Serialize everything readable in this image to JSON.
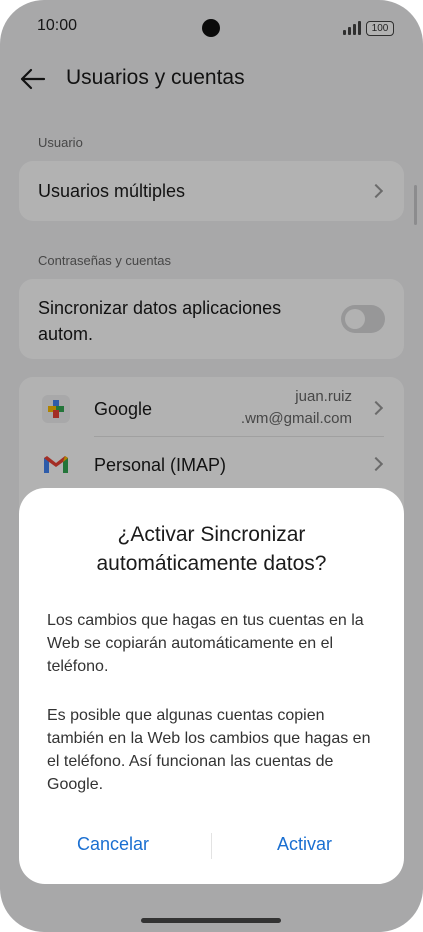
{
  "status_bar": {
    "time": "10:00",
    "battery": "100"
  },
  "header": {
    "title": "Usuarios y cuentas"
  },
  "sections": {
    "user_label": "Usuario",
    "accounts_label": "Contraseñas y cuentas"
  },
  "multi_users": {
    "label": "Usuarios múltiples"
  },
  "sync": {
    "label_line1": "Sincronizar datos aplicaciones",
    "label_line2": "autom.",
    "enabled": false
  },
  "accounts": [
    {
      "name": "Google",
      "email_line1": "juan.ruiz",
      "email_line2": ".wm@gmail.com",
      "icon": "google-settings-icon"
    },
    {
      "name": "Personal (IMAP)",
      "email_line1": "",
      "email_line2": "",
      "icon": "gmail-icon"
    }
  ],
  "dialog": {
    "title_line1": "¿Activar Sincronizar",
    "title_line2": "automáticamente datos?",
    "body_para1": "Los cambios que hagas en tus cuentas en la Web se copiarán automáticamente en el teléfono.",
    "body_para2": "Es posible que algunas cuentas copien también en la Web los cambios que hagas en el teléfono. Así funcionan las cuentas de Google.",
    "cancel_label": "Cancelar",
    "confirm_label": "Activar"
  },
  "colors": {
    "accent": "#1a6fd1",
    "background": "#f1f1f3",
    "card": "#ffffff"
  }
}
